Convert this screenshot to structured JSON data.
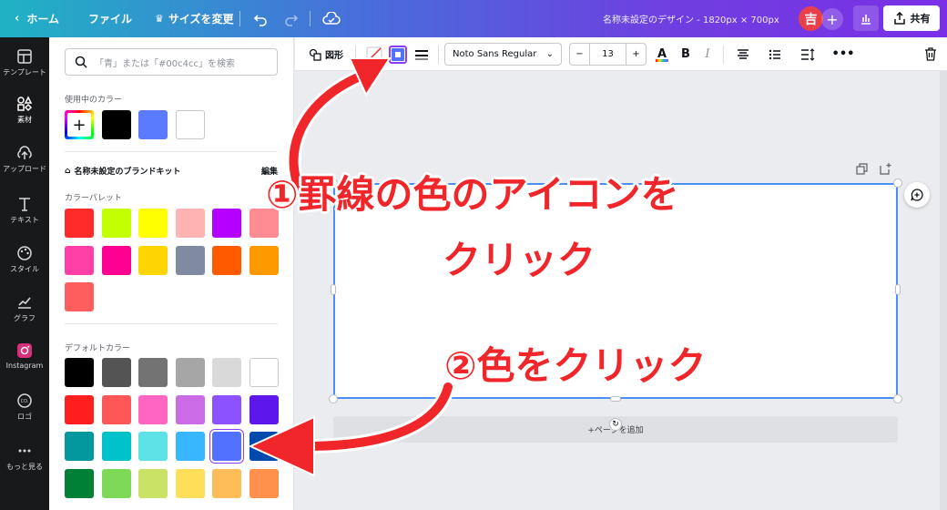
{
  "topbar": {
    "home": "ホーム",
    "file": "ファイル",
    "resize": "サイズを変更",
    "doc_title": "名称未設定のデザイン - 1820px × 700px",
    "avatar": "吉",
    "share": "共有"
  },
  "rail": [
    {
      "label": "テンプレート",
      "icon": "template-icon"
    },
    {
      "label": "素材",
      "icon": "elements-icon"
    },
    {
      "label": "アップロード",
      "icon": "upload-icon"
    },
    {
      "label": "テキスト",
      "icon": "text-icon"
    },
    {
      "label": "スタイル",
      "icon": "style-icon"
    },
    {
      "label": "グラフ",
      "icon": "chart-icon"
    },
    {
      "label": "Instagram",
      "icon": "instagram-icon"
    },
    {
      "label": "ロゴ",
      "icon": "logo-icon"
    },
    {
      "label": "もっと見る",
      "icon": "more-icon"
    }
  ],
  "panel": {
    "search_placeholder": "「青」または「#00c4cc」を検索",
    "in_use_title": "使用中のカラー",
    "in_use_colors": [
      "#000000",
      "#5b7bff",
      "#ffffff"
    ],
    "brand_kit": "名称未設定のブランドキット",
    "edit": "編集",
    "palette_title": "カラーパレット",
    "palette": [
      "#ff2b2b",
      "#c3ff00",
      "#ffff00",
      "#ffb3b3",
      "#b400ff",
      "#ff8c93",
      "#ff3fa5",
      "#ff0093",
      "#ffd500",
      "#808aa0",
      "#ff5a00",
      "#ff9900",
      "#ff5e5e"
    ],
    "default_title": "デフォルトカラー",
    "defaults": [
      "#000000",
      "#545454",
      "#737373",
      "#a6a6a6",
      "#d9d9d9",
      "#ffffff",
      "#ff1f1f",
      "#ff5757",
      "#ff66c4",
      "#cb6ce6",
      "#8c52ff",
      "#5e17eb",
      "#03989e",
      "#00c2cb",
      "#5ce1e6",
      "#38b6ff",
      "#5271ff",
      "#004aad",
      "#008037",
      "#7ed957",
      "#c9e265",
      "#ffde59",
      "#ffbd59",
      "#ff914d"
    ]
  },
  "toolbar": {
    "shape": "図形",
    "font": "Noto Sans Regular",
    "size": "13"
  },
  "canvas": {
    "add_page": "+ページを追加"
  },
  "annotations": {
    "step1_line1": "①罫線の色のアイコンを",
    "step1_line2": "クリック",
    "step2": "②色をクリック"
  },
  "colors": {
    "accent": "#4a8ff5",
    "annotation": "#f0262a"
  }
}
